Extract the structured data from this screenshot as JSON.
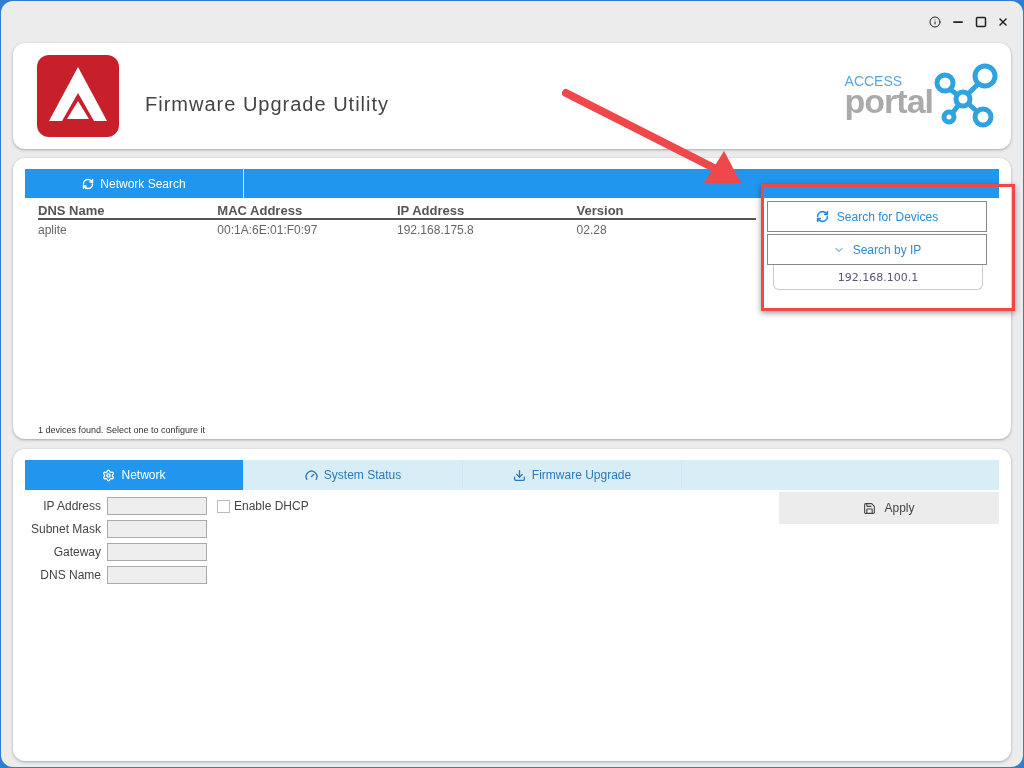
{
  "header": {
    "title": "Firmware Upgrade Utility",
    "logo_text_top": "ACCESS",
    "logo_text_bottom": "portal"
  },
  "search_panel": {
    "tab": {
      "label": "Network Search",
      "selected": true
    },
    "table": {
      "columns": [
        "DNS Name",
        "MAC Address",
        "IP Address",
        "Version"
      ],
      "rows": [
        [
          "aplite",
          "00:1A:6E:01:F0:97",
          "192.168.175.8",
          "02.28"
        ]
      ]
    },
    "status": "1 devices found. Select one to configure it",
    "search_button": "Search for Devices",
    "search_by_ip": {
      "label": "Search by IP",
      "expanded": true,
      "value": "192.168.100.1"
    }
  },
  "config_panel": {
    "tabs": [
      {
        "label": "Network",
        "selected": true
      },
      {
        "label": "System Status",
        "selected": false
      },
      {
        "label": "Firmware Upgrade",
        "selected": false
      }
    ],
    "fields": [
      {
        "label": "IP Address"
      },
      {
        "label": "Subnet Mask"
      },
      {
        "label": "Gateway"
      },
      {
        "label": "DNS Name"
      }
    ],
    "dhcp": {
      "label": "Enable DHCP",
      "checked": false
    },
    "apply_button": "Apply"
  }
}
